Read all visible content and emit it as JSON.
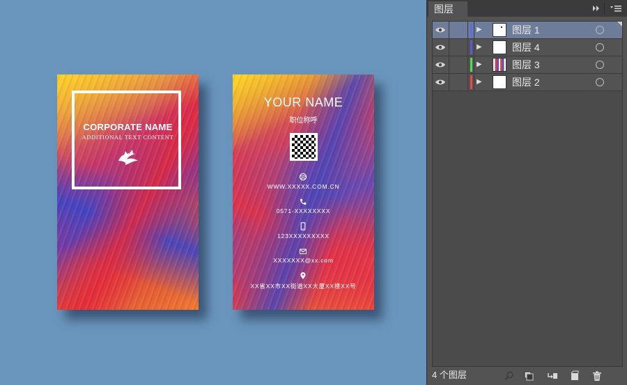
{
  "canvas": {
    "front_card": {
      "corporate_name": "CORPORATE NAME",
      "additional_text": "ADDITIONAL TEXT CONTENT"
    },
    "back_card": {
      "name": "YOUR NAME",
      "title": "职位称呼",
      "website": "WWW.XXXXX.COM.CN",
      "phone": "0571-XXXXXXXX",
      "mobile": "123XXXXXXXXX",
      "email": "XXXXXXX@xx.com",
      "address": "XX省XX市XX街道XX大厦XX楼XX号"
    },
    "background_color": "#6a95bd"
  },
  "layers_panel": {
    "tab_title": "图层",
    "layers": [
      {
        "name": "图层 1",
        "color": "#5a6ee8",
        "selected": true,
        "thumbnail": "blank-with-dot"
      },
      {
        "name": "图层 4",
        "color": "#5a5ad8",
        "selected": false,
        "thumbnail": "blank"
      },
      {
        "name": "图层 3",
        "color": "#4ce04c",
        "selected": false,
        "thumbnail": "artwork"
      },
      {
        "name": "图层 2",
        "color": "#e84a4a",
        "selected": false,
        "thumbnail": "blank"
      }
    ],
    "footer": {
      "layer_count": "4 个图层"
    },
    "icons": [
      "eye-icon",
      "expand-arrow-icon",
      "target-circle-icon",
      "search-icon",
      "clipping-mask-icon",
      "new-sublayer-icon",
      "new-layer-icon",
      "trash-icon",
      "panel-menu-icon",
      "collapse-panel-icon"
    ]
  }
}
